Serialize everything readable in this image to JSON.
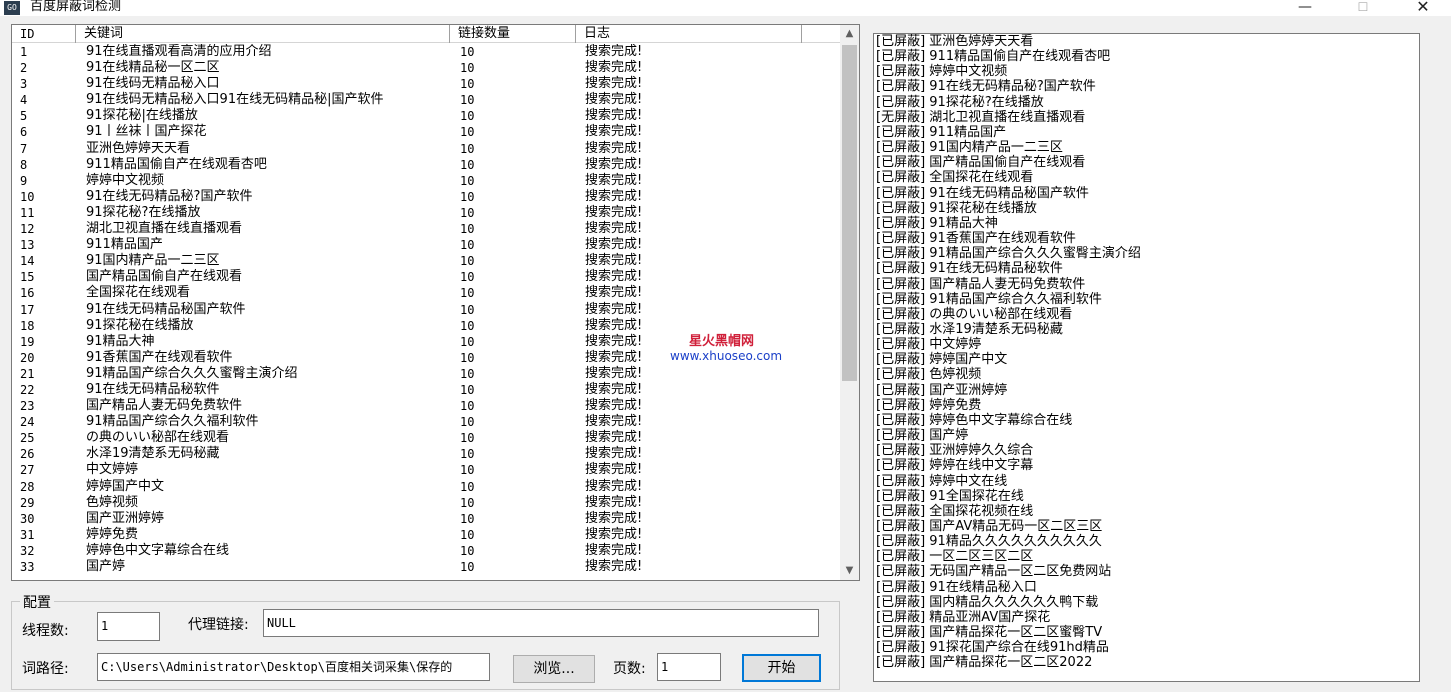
{
  "window": {
    "title": "百度屏蔽词检测",
    "icon_text": "GO",
    "minimize_glyph": "—",
    "maximize_glyph": "☐",
    "close_glyph": "✕"
  },
  "grid": {
    "columns": [
      "ID",
      "关键词",
      "链接数量",
      "日志"
    ],
    "rows": [
      {
        "id": "1",
        "keyword": "91在线直播观看高清的应用介绍",
        "count": "10",
        "log": "搜索完成!"
      },
      {
        "id": "2",
        "keyword": "91在线精品秘一区二区",
        "count": "10",
        "log": "搜索完成!"
      },
      {
        "id": "3",
        "keyword": "91在线码无精品秘入口",
        "count": "10",
        "log": "搜索完成!"
      },
      {
        "id": "4",
        "keyword": "91在线码无精品秘入口91在线无码精品秘|国产软件",
        "count": "10",
        "log": "搜索完成!"
      },
      {
        "id": "5",
        "keyword": "91探花秘|在线播放",
        "count": "10",
        "log": "搜索完成!"
      },
      {
        "id": "6",
        "keyword": "91丨丝袜丨国产探花",
        "count": "10",
        "log": "搜索完成!"
      },
      {
        "id": "7",
        "keyword": "亚洲色婷婷天天看",
        "count": "10",
        "log": "搜索完成!"
      },
      {
        "id": "8",
        "keyword": "911精品国偷自产在线观看杏吧",
        "count": "10",
        "log": "搜索完成!"
      },
      {
        "id": "9",
        "keyword": "婷婷中文视频",
        "count": "10",
        "log": "搜索完成!"
      },
      {
        "id": "10",
        "keyword": "91在线无码精品秘?国产软件",
        "count": "10",
        "log": "搜索完成!"
      },
      {
        "id": "11",
        "keyword": "91探花秘?在线播放",
        "count": "10",
        "log": "搜索完成!"
      },
      {
        "id": "12",
        "keyword": "湖北卫视直播在线直播观看",
        "count": "10",
        "log": "搜索完成!"
      },
      {
        "id": "13",
        "keyword": "911精品国产",
        "count": "10",
        "log": "搜索完成!"
      },
      {
        "id": "14",
        "keyword": "91国内精产品一二三区",
        "count": "10",
        "log": "搜索完成!"
      },
      {
        "id": "15",
        "keyword": "国产精品国偷自产在线观看",
        "count": "10",
        "log": "搜索完成!"
      },
      {
        "id": "16",
        "keyword": "全国探花在线观看",
        "count": "10",
        "log": "搜索完成!"
      },
      {
        "id": "17",
        "keyword": "91在线无码精品秘国产软件",
        "count": "10",
        "log": "搜索完成!"
      },
      {
        "id": "18",
        "keyword": "91探花秘在线播放",
        "count": "10",
        "log": "搜索完成!"
      },
      {
        "id": "19",
        "keyword": "91精品大神",
        "count": "10",
        "log": "搜索完成!"
      },
      {
        "id": "20",
        "keyword": "91香蕉国产在线观看软件",
        "count": "10",
        "log": "搜索完成!"
      },
      {
        "id": "21",
        "keyword": "91精品国产综合久久久蜜臀主演介绍",
        "count": "10",
        "log": "搜索完成!"
      },
      {
        "id": "22",
        "keyword": "91在线无码精品秘软件",
        "count": "10",
        "log": "搜索完成!"
      },
      {
        "id": "23",
        "keyword": "国产精品人妻无码免费软件",
        "count": "10",
        "log": "搜索完成!"
      },
      {
        "id": "24",
        "keyword": "91精品国产综合久久福利软件",
        "count": "10",
        "log": "搜索完成!"
      },
      {
        "id": "25",
        "keyword": "の典のいい秘部在线观看",
        "count": "10",
        "log": "搜索完成!"
      },
      {
        "id": "26",
        "keyword": "水泽19清楚系无码秘藏",
        "count": "10",
        "log": "搜索完成!"
      },
      {
        "id": "27",
        "keyword": "中文婷婷",
        "count": "10",
        "log": "搜索完成!"
      },
      {
        "id": "28",
        "keyword": "婷婷国产中文",
        "count": "10",
        "log": "搜索完成!"
      },
      {
        "id": "29",
        "keyword": "色婷视频",
        "count": "10",
        "log": "搜索完成!"
      },
      {
        "id": "30",
        "keyword": "国产亚洲婷婷",
        "count": "10",
        "log": "搜索完成!"
      },
      {
        "id": "31",
        "keyword": "婷婷免费",
        "count": "10",
        "log": "搜索完成!"
      },
      {
        "id": "32",
        "keyword": "婷婷色中文字幕综合在线",
        "count": "10",
        "log": "搜索完成!"
      },
      {
        "id": "33",
        "keyword": "国产婷",
        "count": "10",
        "log": "搜索完成!"
      }
    ],
    "scroll_up_glyph": "▲",
    "scroll_down_glyph": "▼"
  },
  "watermark": {
    "title": "星火黑帽网",
    "url": "www.xhuoseo.com"
  },
  "config": {
    "legend": "配置",
    "threads_label": "线程数:",
    "threads_value": "1",
    "proxy_label": "代理链接:",
    "proxy_value": "NULL",
    "path_label": "词路径:",
    "path_value": "C:\\Users\\Administrator\\Desktop\\百度相关词采集\\保存的",
    "browse_label": "浏览...",
    "pages_label": "页数:",
    "pages_value": "1",
    "start_label": "开始"
  },
  "results": [
    "[已屏蔽] 亚洲色婷婷天天看",
    "[已屏蔽] 911精品国偷自产在线观看杏吧",
    "[已屏蔽] 婷婷中文视频",
    "[已屏蔽] 91在线无码精品秘?国产软件",
    "[已屏蔽] 91探花秘?在线播放",
    "[无屏蔽] 湖北卫视直播在线直播观看",
    "[已屏蔽] 911精品国产",
    "[已屏蔽] 91国内精产品一二三区",
    "[已屏蔽] 国产精品国偷自产在线观看",
    "[已屏蔽] 全国探花在线观看",
    "[已屏蔽] 91在线无码精品秘国产软件",
    "[已屏蔽] 91探花秘在线播放",
    "[已屏蔽] 91精品大神",
    "[已屏蔽] 91香蕉国产在线观看软件",
    "[已屏蔽] 91精品国产综合久久久蜜臀主演介绍",
    "[已屏蔽] 91在线无码精品秘软件",
    "[已屏蔽] 国产精品人妻无码免费软件",
    "[已屏蔽] 91精品国产综合久久福利软件",
    "[已屏蔽] の典のいい秘部在线观看",
    "[已屏蔽] 水泽19清楚系无码秘藏",
    "[已屏蔽] 中文婷婷",
    "[已屏蔽] 婷婷国产中文",
    "[已屏蔽] 色婷视频",
    "[已屏蔽] 国产亚洲婷婷",
    "[已屏蔽] 婷婷免费",
    "[已屏蔽] 婷婷色中文字幕综合在线",
    "[已屏蔽] 国产婷",
    "[已屏蔽] 亚洲婷婷久久综合",
    "[已屏蔽] 婷婷在线中文字幕",
    "[已屏蔽] 婷婷中文在线",
    "[已屏蔽] 91全国探花在线",
    "[已屏蔽] 全国探花视频在线",
    "[已屏蔽] 国产AV精品无码一区二区三区",
    "[已屏蔽] 91精品久久久久久久久久久久",
    "[已屏蔽] 一区二区三区二区",
    "[已屏蔽] 无码国产精品一区二区免费网站",
    "[已屏蔽] 91在线精品秘入口",
    "[已屏蔽] 国内精品久久久久久久鸭下载",
    "[已屏蔽] 精品亚洲AV国产探花",
    "[已屏蔽] 国产精品探花一区二区蜜臀TV",
    "[已屏蔽] 91探花国产综合在线91hd精品",
    "[已屏蔽] 国产精品探花一区二区2022"
  ]
}
